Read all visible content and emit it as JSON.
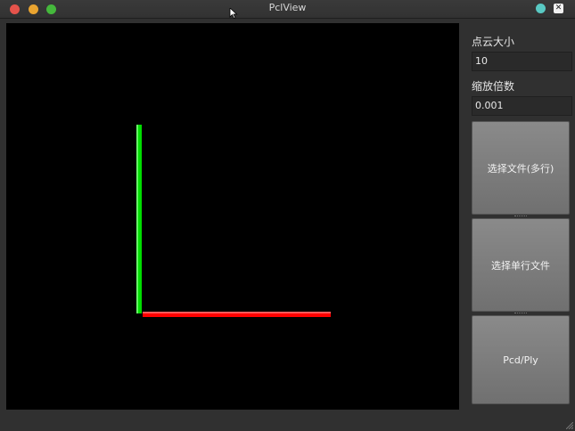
{
  "window": {
    "title": "PclView",
    "controls": {
      "close_color": "#e5534b",
      "minimize_color": "#e9a430",
      "maximize_color": "#45b83c",
      "right_dot_color": "#59c9c3"
    }
  },
  "viewport": {
    "background": "#000000",
    "axes": {
      "y_axis_color": "#00dd00",
      "x_axis_color": "#ff0000"
    }
  },
  "panel": {
    "point_size_label": "点云大小",
    "point_size_value": "10",
    "scale_label": "缩放倍数",
    "scale_value": "0.001",
    "btn_multi_file": "选择文件(多行)",
    "btn_single_file": "选择单行文件",
    "btn_pcd_ply": "Pcd/Ply"
  }
}
